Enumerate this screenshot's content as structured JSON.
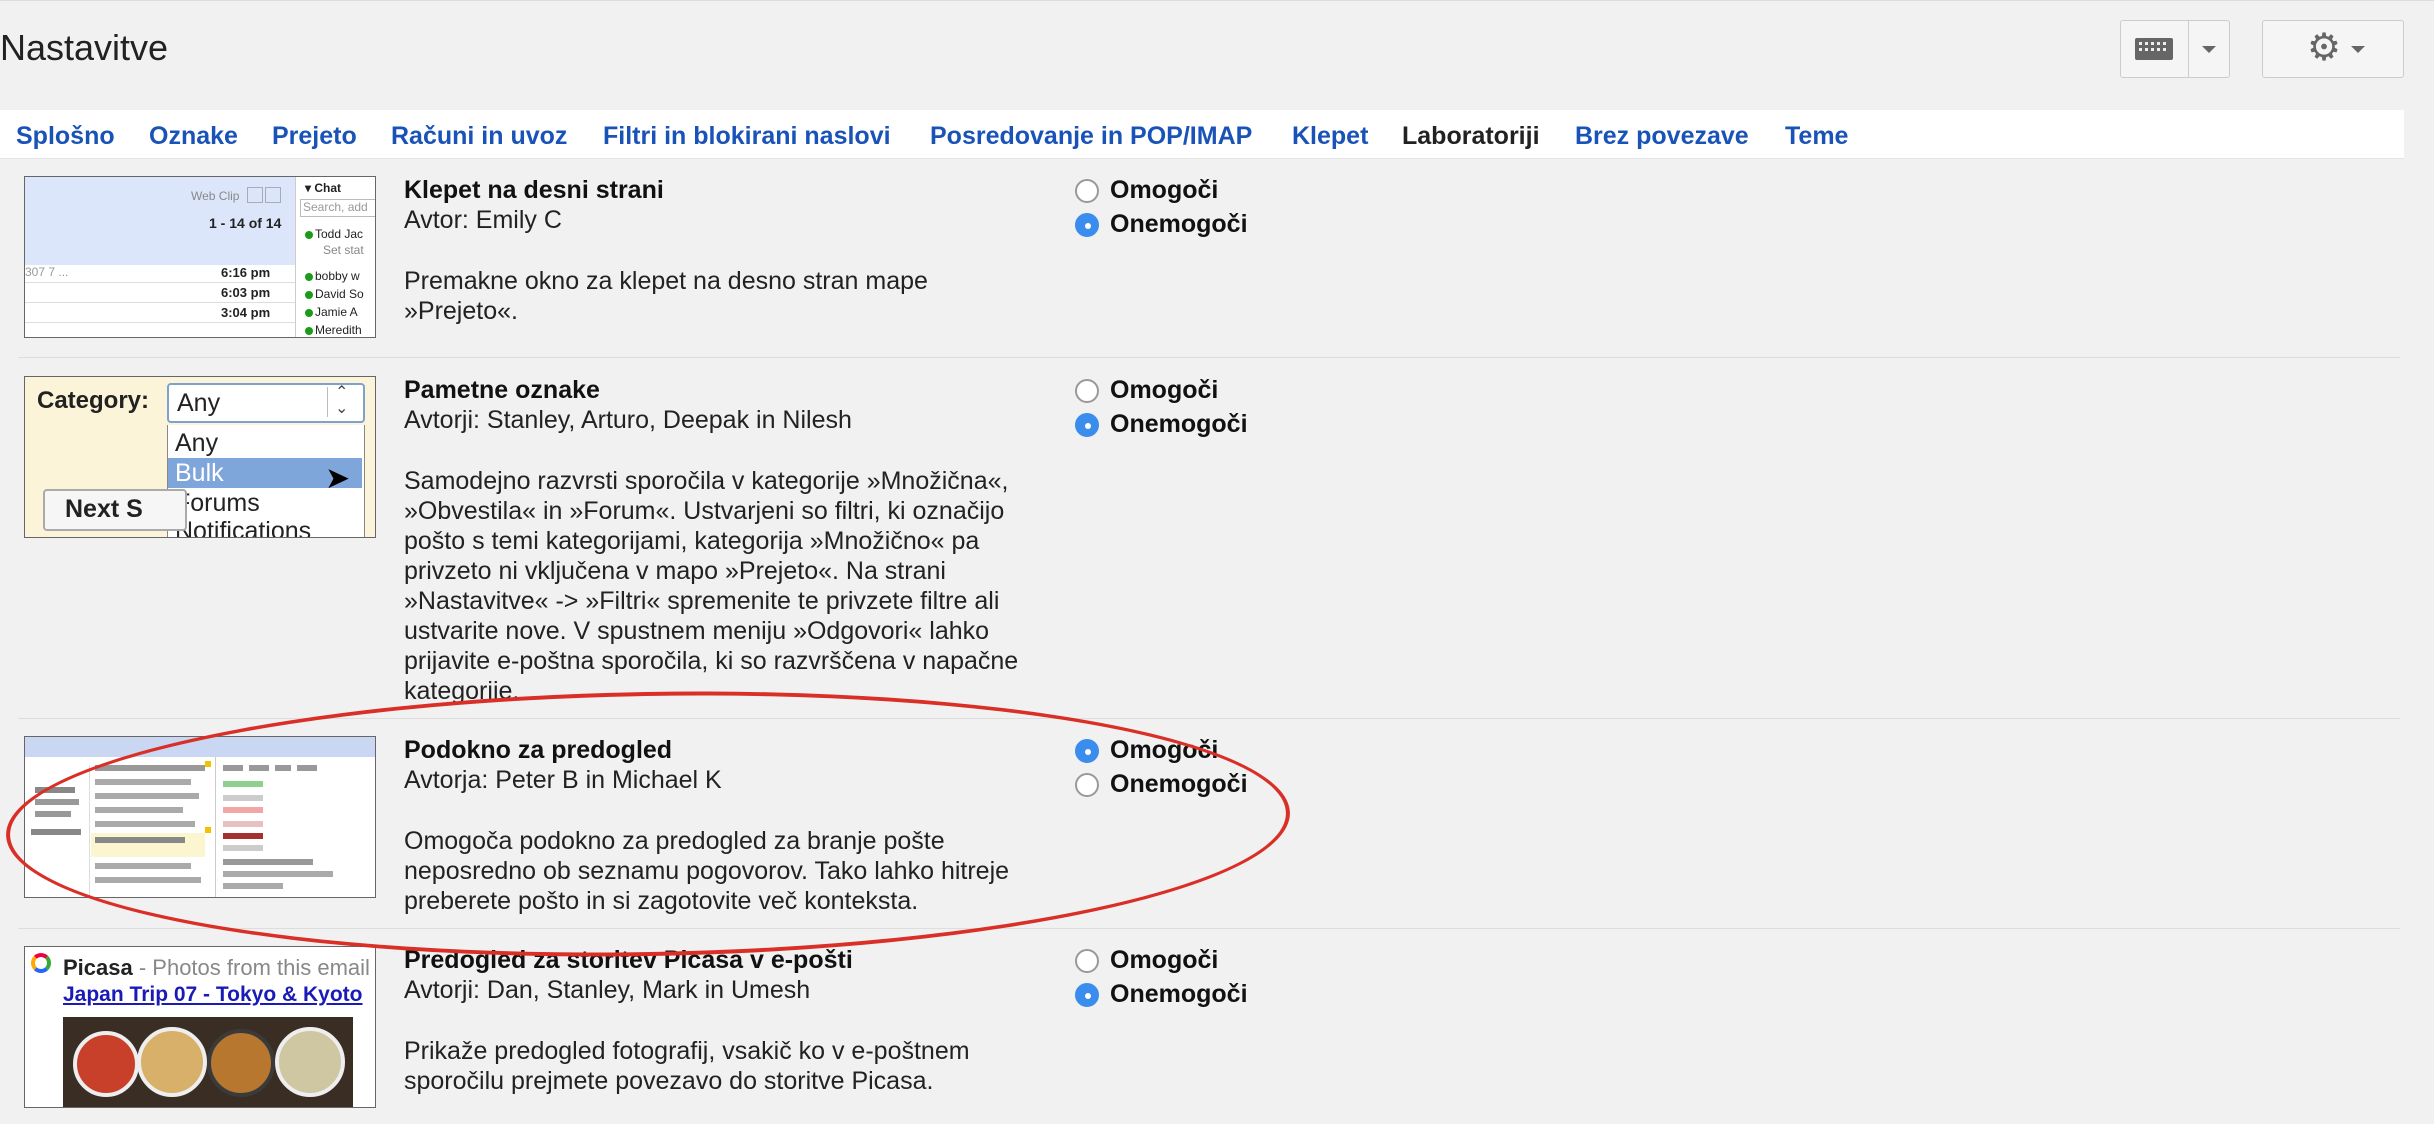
{
  "page": {
    "title": "Nastavitve"
  },
  "tabs": [
    {
      "label": "Splošno"
    },
    {
      "label": "Oznake"
    },
    {
      "label": "Prejeto"
    },
    {
      "label": "Računi in uvoz"
    },
    {
      "label": "Filtri in blokirani naslovi"
    },
    {
      "label": "Posredovanje in POP/IMAP"
    },
    {
      "label": "Klepet"
    },
    {
      "label": "Laboratoriji",
      "active": true
    },
    {
      "label": "Brez povezave"
    },
    {
      "label": "Teme"
    }
  ],
  "radio_labels": {
    "enable": "Omogoči",
    "disable": "Onemogoči"
  },
  "labs": [
    {
      "title": "Klepet na desni strani",
      "author": "Avtor: Emily C",
      "description": "Premakne okno za klepet na desno stran mape »Prejeto«.",
      "selected": "disable",
      "thumb": {
        "webclip": "Web Clip",
        "count": "1 - 14 of 14",
        "chat_label": "Chat",
        "search_placeholder": "Search, add",
        "contacts": [
          "Todd Jac",
          "Set stat",
          "bobby w",
          "David So",
          "Jamie A",
          "Meredith"
        ],
        "times": [
          "6:16 pm",
          "6:03 pm",
          "3:04 pm"
        ],
        "row_left": "307 7 ..."
      }
    },
    {
      "title": "Pametne oznake",
      "author": "Avtorji: Stanley, Arturo, Deepak in Nilesh",
      "description": "Samodejno razvrsti sporočila v kategorije »Množična«, »Obvestila« in »Forum«. Ustvarjeni so filtri, ki označijo pošto s temi kategorijami, kategorija »Množično« pa privzeto ni vključena v mapo »Prejeto«. Na strani »Nastavitve« -> »Filtri« spremenite te privzete filtre ali ustvarite nove. V spustnem meniju »Odgovori« lahko prijavite e-poštna sporočila, ki so razvrščena v napačne kategorije.",
      "selected": "disable",
      "thumb": {
        "category_label": "Category:",
        "selected_value": "Any",
        "options": [
          "Any",
          "Bulk",
          "Forums",
          "Notifications"
        ],
        "next_button": "Next S"
      }
    },
    {
      "title": "Podokno za predogled",
      "author": "Avtorja: Peter B in Michael K",
      "description": "Omogoča podokno za predogled za branje pošte neposredno ob seznamu pogovorov. Tako lahko hitreje preberete pošto in si zagotovite več konteksta.",
      "selected": "enable"
    },
    {
      "title": "Predogled za storitev Picasa v e-pošti",
      "author": "Avtorji: Dan, Stanley, Mark in Umesh",
      "description": "Prikaže predogled fotografij, vsakič ko v e-poštnem sporočilu prejmete povezavo do storitve Picasa.",
      "selected": "disable",
      "thumb": {
        "brand": "Picasa",
        "subtitle": " - Photos from this email",
        "album_link": "Japan Trip 07 - Tokyo & Kyoto"
      }
    }
  ],
  "colors": {
    "link": "#1a53b8",
    "radio_on": "#3b8ded",
    "highlight_ellipse": "#d92f26"
  },
  "icons": [
    "keyboard-icon",
    "gear-icon",
    "chevron-down-icon"
  ]
}
